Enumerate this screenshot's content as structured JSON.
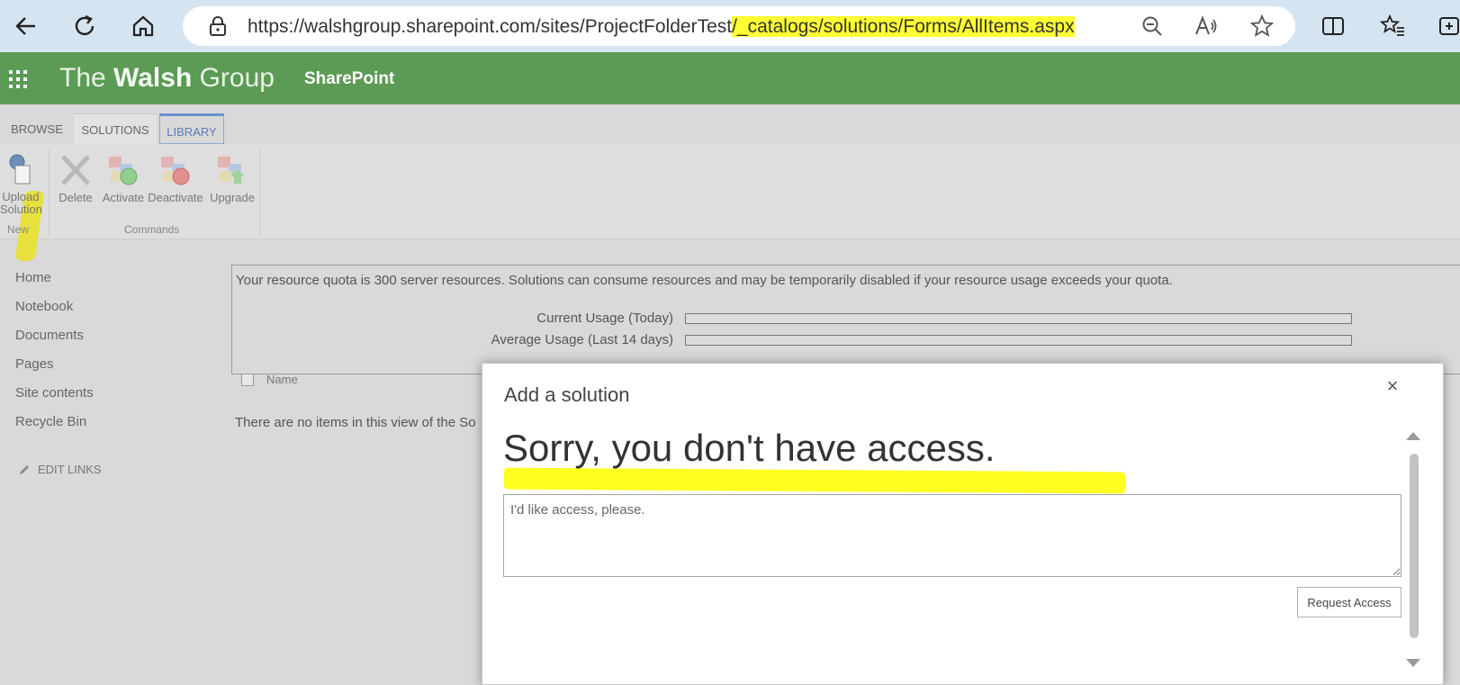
{
  "browser": {
    "url_prefix": "https://walshgroup.sharepoint.com/sites/ProjectFolderTest",
    "url_highlighted": "/_catalogs/solutions/Forms/AllItems.aspx",
    "icons": [
      "back-icon",
      "refresh-icon",
      "home-icon",
      "lock-icon",
      "zoom-out-icon",
      "read-aloud-icon",
      "favorite-star-icon",
      "split-screen-icon",
      "favorites-icon",
      "collections-icon"
    ]
  },
  "suite": {
    "brand_light1": "The ",
    "brand_bold": "Walsh",
    "brand_light2": " Group",
    "app_name": "SharePoint",
    "color": "#5b9b55"
  },
  "ribbon": {
    "tabs": [
      "BROWSE",
      "SOLUTIONS",
      "LIBRARY"
    ],
    "buttons": {
      "upload_line1": "Upload",
      "upload_line2": "Solution",
      "delete": "Delete",
      "activate": "Activate",
      "deactivate": "Deactivate",
      "upgrade": "Upgrade"
    },
    "groups": {
      "new": "New",
      "commands": "Commands"
    }
  },
  "leftnav": {
    "items": [
      "Home",
      "Notebook",
      "Documents",
      "Pages",
      "Site contents",
      "Recycle Bin"
    ],
    "edit_links": "EDIT LINKS"
  },
  "quota": {
    "text": "Your resource quota is 300 server resources. Solutions can consume resources and may be temporarily disabled if your resource usage exceeds your quota.",
    "current_label": "Current Usage (Today)",
    "average_label": "Average Usage (Last 14 days)"
  },
  "list": {
    "name_header": "Name",
    "empty_text": "There are no items in this view of the So"
  },
  "dialog": {
    "title": "Add a solution",
    "heading": "Sorry, you don't have access.",
    "message_value": "I'd like access, please.",
    "request_button": "Request Access",
    "close": "×"
  },
  "highlight_color": "#ffff33"
}
